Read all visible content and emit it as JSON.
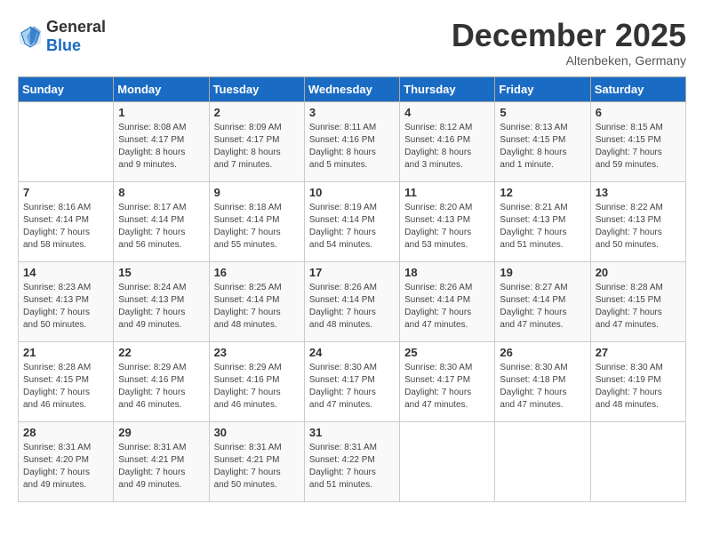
{
  "logo": {
    "general": "General",
    "blue": "Blue"
  },
  "title": "December 2025",
  "location": "Altenbeken, Germany",
  "days_of_week": [
    "Sunday",
    "Monday",
    "Tuesday",
    "Wednesday",
    "Thursday",
    "Friday",
    "Saturday"
  ],
  "weeks": [
    [
      {
        "day": "",
        "info": ""
      },
      {
        "day": "1",
        "info": "Sunrise: 8:08 AM\nSunset: 4:17 PM\nDaylight: 8 hours\nand 9 minutes."
      },
      {
        "day": "2",
        "info": "Sunrise: 8:09 AM\nSunset: 4:17 PM\nDaylight: 8 hours\nand 7 minutes."
      },
      {
        "day": "3",
        "info": "Sunrise: 8:11 AM\nSunset: 4:16 PM\nDaylight: 8 hours\nand 5 minutes."
      },
      {
        "day": "4",
        "info": "Sunrise: 8:12 AM\nSunset: 4:16 PM\nDaylight: 8 hours\nand 3 minutes."
      },
      {
        "day": "5",
        "info": "Sunrise: 8:13 AM\nSunset: 4:15 PM\nDaylight: 8 hours\nand 1 minute."
      },
      {
        "day": "6",
        "info": "Sunrise: 8:15 AM\nSunset: 4:15 PM\nDaylight: 7 hours\nand 59 minutes."
      }
    ],
    [
      {
        "day": "7",
        "info": "Sunrise: 8:16 AM\nSunset: 4:14 PM\nDaylight: 7 hours\nand 58 minutes."
      },
      {
        "day": "8",
        "info": "Sunrise: 8:17 AM\nSunset: 4:14 PM\nDaylight: 7 hours\nand 56 minutes."
      },
      {
        "day": "9",
        "info": "Sunrise: 8:18 AM\nSunset: 4:14 PM\nDaylight: 7 hours\nand 55 minutes."
      },
      {
        "day": "10",
        "info": "Sunrise: 8:19 AM\nSunset: 4:14 PM\nDaylight: 7 hours\nand 54 minutes."
      },
      {
        "day": "11",
        "info": "Sunrise: 8:20 AM\nSunset: 4:13 PM\nDaylight: 7 hours\nand 53 minutes."
      },
      {
        "day": "12",
        "info": "Sunrise: 8:21 AM\nSunset: 4:13 PM\nDaylight: 7 hours\nand 51 minutes."
      },
      {
        "day": "13",
        "info": "Sunrise: 8:22 AM\nSunset: 4:13 PM\nDaylight: 7 hours\nand 50 minutes."
      }
    ],
    [
      {
        "day": "14",
        "info": "Sunrise: 8:23 AM\nSunset: 4:13 PM\nDaylight: 7 hours\nand 50 minutes."
      },
      {
        "day": "15",
        "info": "Sunrise: 8:24 AM\nSunset: 4:13 PM\nDaylight: 7 hours\nand 49 minutes."
      },
      {
        "day": "16",
        "info": "Sunrise: 8:25 AM\nSunset: 4:14 PM\nDaylight: 7 hours\nand 48 minutes."
      },
      {
        "day": "17",
        "info": "Sunrise: 8:26 AM\nSunset: 4:14 PM\nDaylight: 7 hours\nand 48 minutes."
      },
      {
        "day": "18",
        "info": "Sunrise: 8:26 AM\nSunset: 4:14 PM\nDaylight: 7 hours\nand 47 minutes."
      },
      {
        "day": "19",
        "info": "Sunrise: 8:27 AM\nSunset: 4:14 PM\nDaylight: 7 hours\nand 47 minutes."
      },
      {
        "day": "20",
        "info": "Sunrise: 8:28 AM\nSunset: 4:15 PM\nDaylight: 7 hours\nand 47 minutes."
      }
    ],
    [
      {
        "day": "21",
        "info": "Sunrise: 8:28 AM\nSunset: 4:15 PM\nDaylight: 7 hours\nand 46 minutes."
      },
      {
        "day": "22",
        "info": "Sunrise: 8:29 AM\nSunset: 4:16 PM\nDaylight: 7 hours\nand 46 minutes."
      },
      {
        "day": "23",
        "info": "Sunrise: 8:29 AM\nSunset: 4:16 PM\nDaylight: 7 hours\nand 46 minutes."
      },
      {
        "day": "24",
        "info": "Sunrise: 8:30 AM\nSunset: 4:17 PM\nDaylight: 7 hours\nand 47 minutes."
      },
      {
        "day": "25",
        "info": "Sunrise: 8:30 AM\nSunset: 4:17 PM\nDaylight: 7 hours\nand 47 minutes."
      },
      {
        "day": "26",
        "info": "Sunrise: 8:30 AM\nSunset: 4:18 PM\nDaylight: 7 hours\nand 47 minutes."
      },
      {
        "day": "27",
        "info": "Sunrise: 8:30 AM\nSunset: 4:19 PM\nDaylight: 7 hours\nand 48 minutes."
      }
    ],
    [
      {
        "day": "28",
        "info": "Sunrise: 8:31 AM\nSunset: 4:20 PM\nDaylight: 7 hours\nand 49 minutes."
      },
      {
        "day": "29",
        "info": "Sunrise: 8:31 AM\nSunset: 4:21 PM\nDaylight: 7 hours\nand 49 minutes."
      },
      {
        "day": "30",
        "info": "Sunrise: 8:31 AM\nSunset: 4:21 PM\nDaylight: 7 hours\nand 50 minutes."
      },
      {
        "day": "31",
        "info": "Sunrise: 8:31 AM\nSunset: 4:22 PM\nDaylight: 7 hours\nand 51 minutes."
      },
      {
        "day": "",
        "info": ""
      },
      {
        "day": "",
        "info": ""
      },
      {
        "day": "",
        "info": ""
      }
    ]
  ]
}
